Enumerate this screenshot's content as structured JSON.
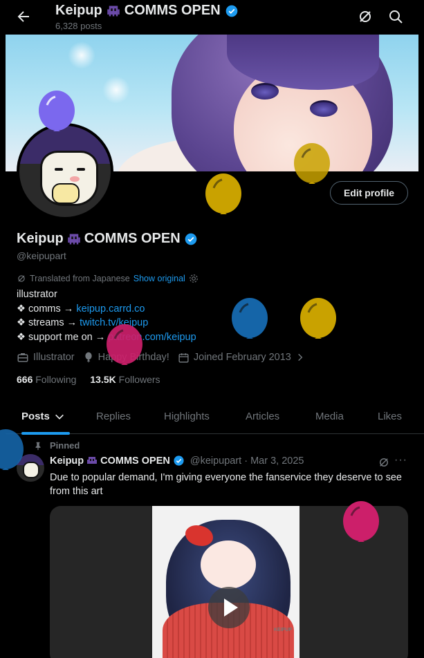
{
  "header": {
    "title": "Keipup",
    "title_suffix": "COMMS OPEN",
    "post_count": "6,328 posts"
  },
  "profile": {
    "edit_label": "Edit profile",
    "name": "Keipup",
    "name_suffix": "COMMS OPEN",
    "handle": "@keipupart",
    "translated_label": "Translated from Japanese",
    "show_original_label": "Show original",
    "bio": {
      "line1": "illustrator",
      "line2_prefix": "❖ comms → ",
      "line2_link": "keipup.carrd.co",
      "line3_prefix": "❖ streams → ",
      "line3_link": "twitch.tv/keipup",
      "line4_prefix": "❖ support me on → ",
      "line4_link": "patreon.com/keipup"
    },
    "meta": {
      "profession": "Illustrator",
      "birthday": "Happy Birthday!",
      "joined": "Joined February 2013"
    },
    "following_count": "666",
    "following_label": "Following",
    "followers_count": "13.5K",
    "followers_label": "Followers"
  },
  "tabs": [
    {
      "label": "Posts"
    },
    {
      "label": "Replies"
    },
    {
      "label": "Highlights"
    },
    {
      "label": "Articles"
    },
    {
      "label": "Media"
    },
    {
      "label": "Likes"
    }
  ],
  "post": {
    "pinned_label": "Pinned",
    "author_name": "Keipup",
    "author_suffix": "COMMS OPEN",
    "meta": "@keipupart · Mar 3, 2025",
    "more_label": "···",
    "text": "Due to popular demand, I'm giving everyone the fanservice they deserve to see from this art",
    "media_signature": "KEIPUP"
  },
  "colors": {
    "background": "#000000",
    "accent": "#1d9bf0",
    "text_primary": "#e7e9ea",
    "text_secondary": "#71767b",
    "balloon_purple": "#7b68ee",
    "balloon_gold": "#c9a200",
    "balloon_blue": "#1565a8",
    "balloon_magenta": "#cc1f6a"
  },
  "icons": [
    "back-arrow-icon",
    "grok-icon",
    "search-icon",
    "alien-emoji-icon",
    "verified-badge-icon",
    "gear-icon",
    "briefcase-icon",
    "balloon-icon",
    "calendar-icon",
    "chevron-right-icon",
    "chevron-down-icon",
    "pin-icon",
    "play-icon"
  ]
}
